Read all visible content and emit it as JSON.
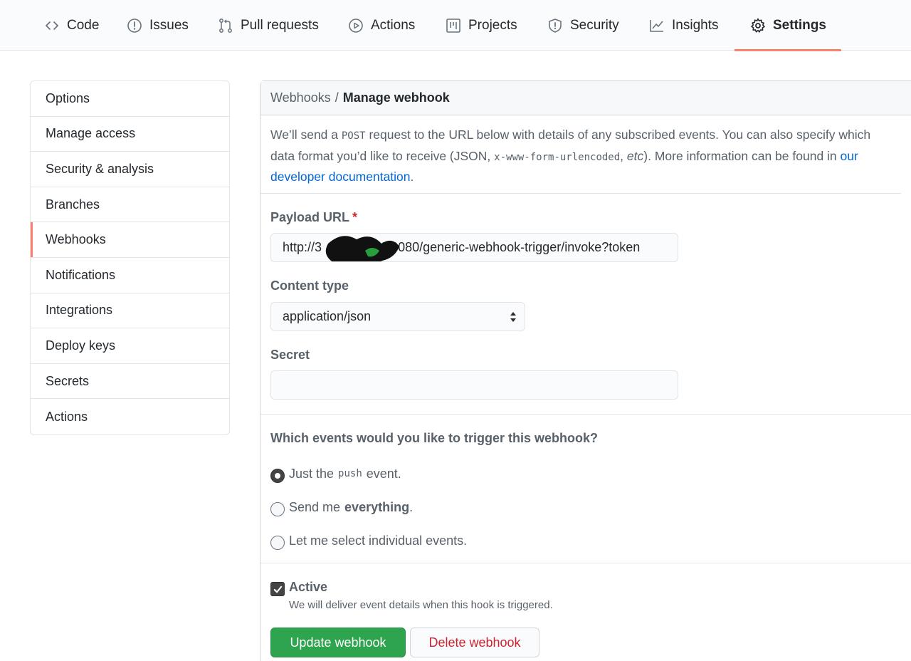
{
  "repo_nav": {
    "tabs": [
      {
        "label": "Code",
        "icon": "code-icon"
      },
      {
        "label": "Issues",
        "icon": "issue-icon"
      },
      {
        "label": "Pull requests",
        "icon": "pull-request-icon"
      },
      {
        "label": "Actions",
        "icon": "play-icon"
      },
      {
        "label": "Projects",
        "icon": "project-icon"
      },
      {
        "label": "Security",
        "icon": "shield-icon"
      },
      {
        "label": "Insights",
        "icon": "graph-icon"
      },
      {
        "label": "Settings",
        "icon": "gear-icon",
        "selected": true
      }
    ]
  },
  "sidebar": {
    "items": [
      {
        "label": "Options"
      },
      {
        "label": "Manage access"
      },
      {
        "label": "Security & analysis"
      },
      {
        "label": "Branches"
      },
      {
        "label": "Webhooks",
        "selected": true
      },
      {
        "label": "Notifications"
      },
      {
        "label": "Integrations"
      },
      {
        "label": "Deploy keys"
      },
      {
        "label": "Secrets"
      },
      {
        "label": "Actions"
      }
    ]
  },
  "header": {
    "parent": "Webhooks",
    "separator": "/",
    "current": "Manage webhook"
  },
  "intro": {
    "part1": "We’ll send a ",
    "code1": "POST",
    "part2": " request to the URL below with details of any subscribed events. You can also specify which data format you’d like to receive (JSON, ",
    "code2": "x-www-form-urlencoded",
    "part3": ", ",
    "etc": "etc",
    "part4": "). More information can be found in ",
    "link": "our developer documentation",
    "part5": "."
  },
  "form": {
    "payload_label": "Payload URL",
    "required_mark": "*",
    "payload_value": "http://3    21:8080/generic-webhook-trigger/invoke?token",
    "content_type_label": "Content type",
    "content_type_value": "application/json",
    "secret_label": "Secret",
    "secret_value": ""
  },
  "events": {
    "question": "Which events would you like to trigger this webhook?",
    "options": [
      {
        "before": "Just the",
        "code": "push",
        "after": "event.",
        "checked": true
      },
      {
        "before": "Send me",
        "bold": "everything",
        "after": ".",
        "checked": false
      },
      {
        "before": "Let me select individual events.",
        "checked": false
      }
    ]
  },
  "active": {
    "label": "Active",
    "note": "We will deliver event details when this hook is triggered.",
    "checked": true
  },
  "buttons": {
    "update": "Update webhook",
    "delete": "Delete webhook"
  },
  "colors": {
    "accent_underline": "#f9826c",
    "primary_button": "#2ea44f",
    "danger_text": "#cb2431",
    "link": "#0366d6"
  }
}
